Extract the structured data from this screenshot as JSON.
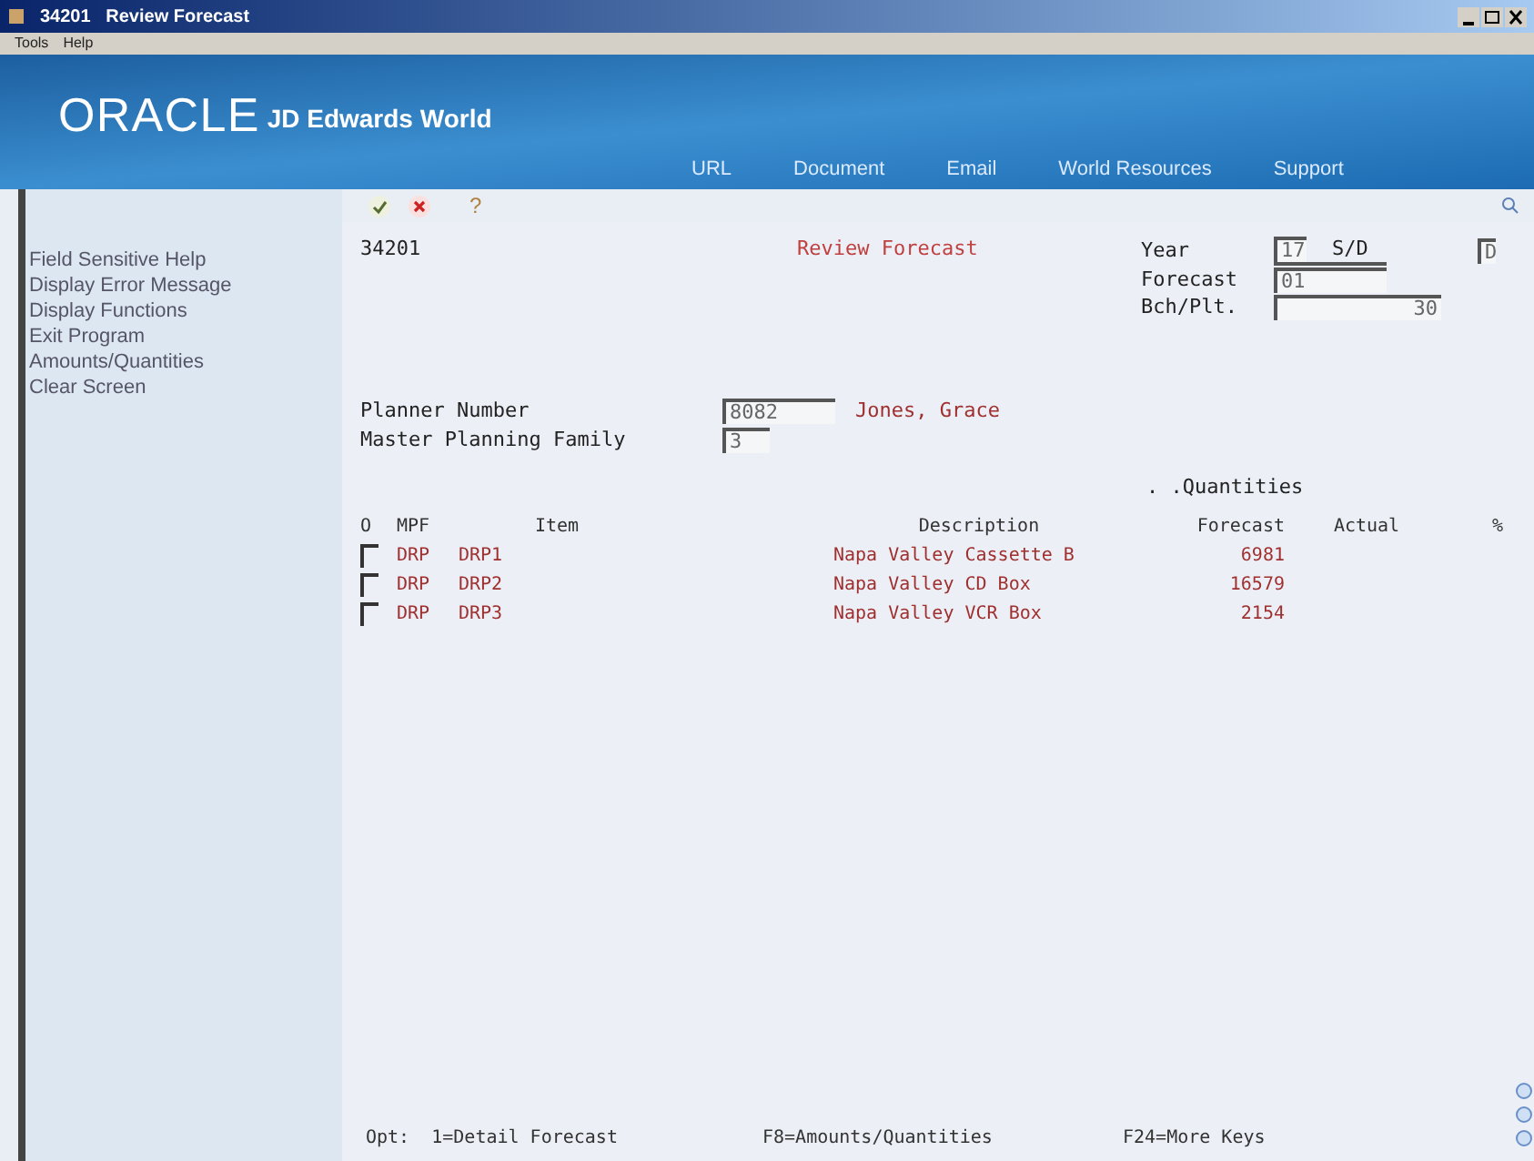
{
  "window": {
    "title_number": "34201",
    "title": "Review Forecast"
  },
  "menu": [
    "Tools",
    "Help"
  ],
  "banner": {
    "logo": "ORACLE",
    "product": "JD Edwards World",
    "links": [
      "URL",
      "Document",
      "Email",
      "World Resources",
      "Support"
    ]
  },
  "toolbar": {
    "help": "?"
  },
  "sidebar": {
    "items": [
      "Field Sensitive Help",
      "Display Error Message",
      "Display Functions",
      "Exit Program",
      "Amounts/Quantities",
      "Clear Screen"
    ]
  },
  "form": {
    "program": "34201",
    "title": "Review Forecast",
    "year": {
      "label": "Year",
      "value": "17"
    },
    "sd": {
      "label": "S/D",
      "value": "D"
    },
    "forecast": {
      "label": "Forecast",
      "value": "01"
    },
    "bch": {
      "label": "Bch/Plt.",
      "value": "30"
    },
    "planner": {
      "label": "Planner Number",
      "value": "8082",
      "name": "Jones, Grace"
    },
    "family": {
      "label": "Master Planning Family",
      "value": "3"
    }
  },
  "table": {
    "group": ". .Quantities",
    "columns": [
      "O",
      "MPF",
      "Item",
      "Description",
      "Forecast",
      "Actual",
      "%"
    ],
    "rows": [
      {
        "selected": false,
        "mpf": "DRP",
        "item": "DRP1",
        "description": "Napa Valley Cassette B",
        "forecast": "6981"
      },
      {
        "selected": false,
        "mpf": "DRP",
        "item": "DRP2",
        "description": "Napa Valley CD Box",
        "forecast": "16579"
      },
      {
        "selected": false,
        "mpf": "DRP",
        "item": "DRP3",
        "description": "Napa Valley VCR Box",
        "forecast": "2154"
      }
    ]
  },
  "footer": [
    "Opt:  1=Detail Forecast",
    "F8=Amounts/Quantities",
    "F24=More Keys"
  ]
}
